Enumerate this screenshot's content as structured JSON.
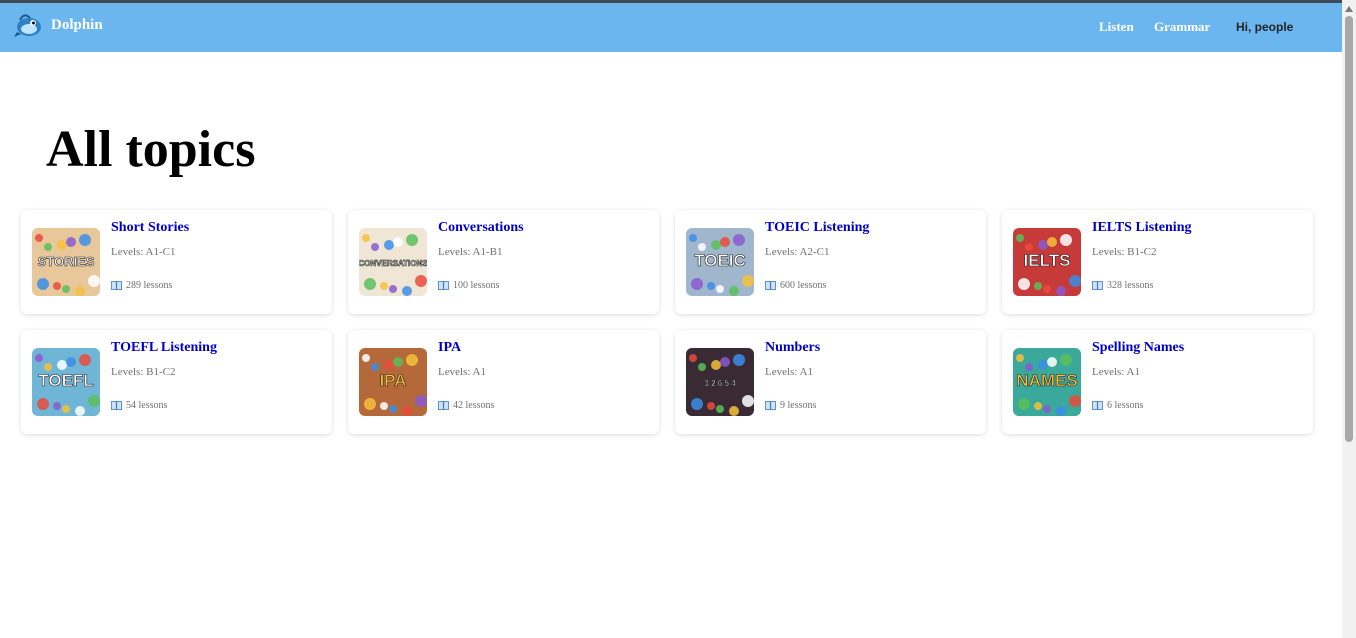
{
  "navbar": {
    "brand": "Dolphin",
    "links": [
      "Listen",
      "Grammar"
    ],
    "greeting": "Hi, people"
  },
  "page": {
    "title": "All topics"
  },
  "topics": [
    {
      "title": "Short Stories",
      "levels": "Levels: A1-C1",
      "lessons": "289 lessons",
      "thumb_text": "STORIES",
      "thumb_bg": "#e8c89a"
    },
    {
      "title": "Conversations",
      "levels": "Levels: A1-B1",
      "lessons": "100 lessons",
      "thumb_text": "CONVERSATIONS",
      "thumb_bg": "#efe6d6"
    },
    {
      "title": "TOEIC Listening",
      "levels": "Levels: A2-C1",
      "lessons": "600 lessons",
      "thumb_text": "TOEIC",
      "thumb_bg": "#9fb6cc"
    },
    {
      "title": "IELTS Listening",
      "levels": "Levels: B1-C2",
      "lessons": "328 lessons",
      "thumb_text": "IELTS",
      "thumb_bg": "#c63a3a"
    },
    {
      "title": "TOEFL Listening",
      "levels": "Levels: B1-C2",
      "lessons": "54 lessons",
      "thumb_text": "TOEFL",
      "thumb_bg": "#6fb6d6"
    },
    {
      "title": "IPA",
      "levels": "Levels: A1",
      "lessons": "42 lessons",
      "thumb_text": "IPA",
      "thumb_bg": "#b5683a"
    },
    {
      "title": "Numbers",
      "levels": "Levels: A1",
      "lessons": "9 lessons",
      "thumb_text": "3 2 6 5 4",
      "thumb_bg": "#3a2a34"
    },
    {
      "title": "Spelling Names",
      "levels": "Levels: A1",
      "lessons": "6 lessons",
      "thumb_text": "NAMES",
      "thumb_bg": "#3aa89a"
    }
  ],
  "colors": {
    "navbar": "#6cb6f0",
    "title_link": "#0000cc",
    "muted": "#707070"
  }
}
